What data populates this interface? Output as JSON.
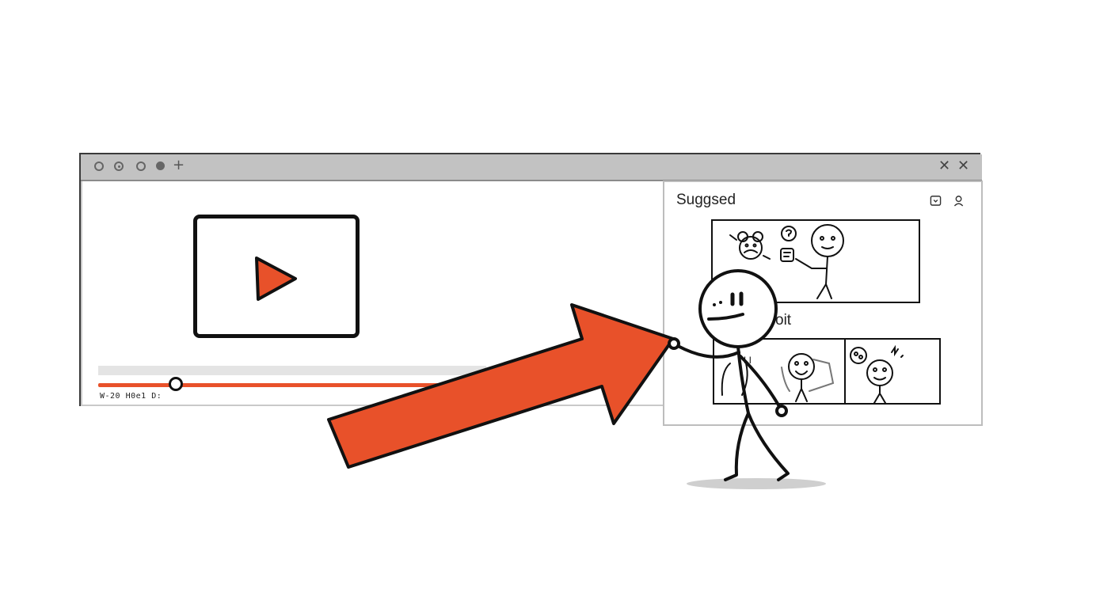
{
  "window": {
    "controls": [
      "circle-icon",
      "dot-circle-icon",
      "circle-icon",
      "filled-circle-icon"
    ],
    "new_tab": "+",
    "close_buttons": [
      "✕",
      "✕"
    ]
  },
  "player": {
    "play_icon": "play-icon",
    "progress": 0.2,
    "time_text": "W-20 H0e1 D:"
  },
  "sidebar": {
    "title": "Suggsed",
    "icons": [
      "cast-icon",
      "user-icon"
    ],
    "caption": "oit"
  },
  "colors": {
    "accent": "#e8512a",
    "ink": "#111111",
    "titlebar": "#c2c2c2"
  }
}
